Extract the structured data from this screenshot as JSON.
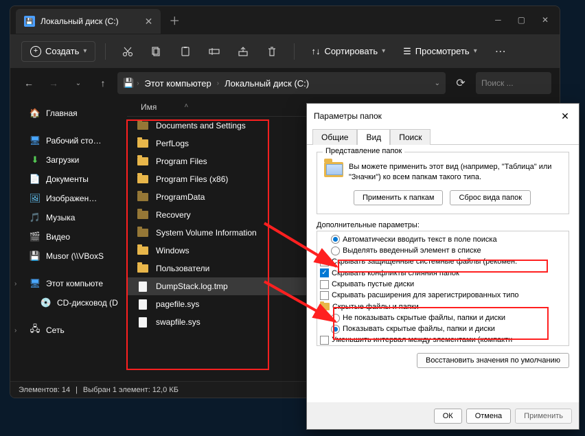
{
  "tab": {
    "title": "Локальный диск (C:)"
  },
  "toolbar": {
    "new": "Создать",
    "sort": "Сортировать",
    "view": "Просмотреть"
  },
  "breadcrumb": {
    "root": "Этот компьютер",
    "drive": "Локальный диск (C:)"
  },
  "search": {
    "placeholder": "Поиск ..."
  },
  "sidebar": {
    "home": "Главная",
    "desktop": "Рабочий сто…",
    "downloads": "Загрузки",
    "documents": "Документы",
    "pictures": "Изображен…",
    "music": "Музыка",
    "videos": "Видео",
    "musor": "Musor (\\\\VBoxS",
    "thispc": "Этот компьюте",
    "cdrom": "CD-дисковод (D",
    "network": "Сеть"
  },
  "columns": {
    "name": "Имя"
  },
  "files": [
    {
      "name": "Documents and Settings",
      "type": "folder",
      "hidden": true
    },
    {
      "name": "PerfLogs",
      "type": "folder"
    },
    {
      "name": "Program Files",
      "type": "folder"
    },
    {
      "name": "Program Files (x86)",
      "type": "folder"
    },
    {
      "name": "ProgramData",
      "type": "folder",
      "hidden": true
    },
    {
      "name": "Recovery",
      "type": "folder",
      "hidden": true
    },
    {
      "name": "System Volume Information",
      "type": "folder",
      "hidden": true
    },
    {
      "name": "Windows",
      "type": "folder"
    },
    {
      "name": "Пользователи",
      "type": "folder"
    },
    {
      "name": "DumpStack.log.tmp",
      "type": "file",
      "selected": true
    },
    {
      "name": "pagefile.sys",
      "type": "file"
    },
    {
      "name": "swapfile.sys",
      "type": "file"
    }
  ],
  "status": {
    "count": "Элементов: 14",
    "selection": "Выбран 1 элемент: 12,0 КБ"
  },
  "dialog": {
    "title": "Параметры папок",
    "tabs": {
      "general": "Общие",
      "view": "Вид",
      "search": "Поиск"
    },
    "group_title": "Представление папок",
    "group_text": "Вы можете применить этот вид (например, \"Таблица\" или \"Значки\") ко всем папкам такого типа.",
    "apply_folders": "Применить к папкам",
    "reset_folders": "Сброс вида папок",
    "advanced_label": "Дополнительные параметры:",
    "adv": {
      "auto_type": "Автоматически вводить текст в поле поиска",
      "select_typed": "Выделять введенный элемент в списке",
      "hide_protected": "Скрывать защищенные системные файлы (рекомен.",
      "hide_merge": "Скрывать конфликты слияния папок",
      "hide_empty": "Скрывать пустые диски",
      "hide_ext": "Скрывать расширения для зарегистрированных типо",
      "hidden_group": "Скрытые файлы и папки",
      "hidden_off": "Не показывать скрытые файлы, папки и диски",
      "hidden_on": "Показывать скрытые файлы, папки и диски",
      "compact": "Уменьшить интервал между элементами (компактн"
    },
    "restore": "Восстановить значения по умолчанию",
    "ok": "ОК",
    "cancel": "Отмена",
    "apply": "Применить"
  }
}
